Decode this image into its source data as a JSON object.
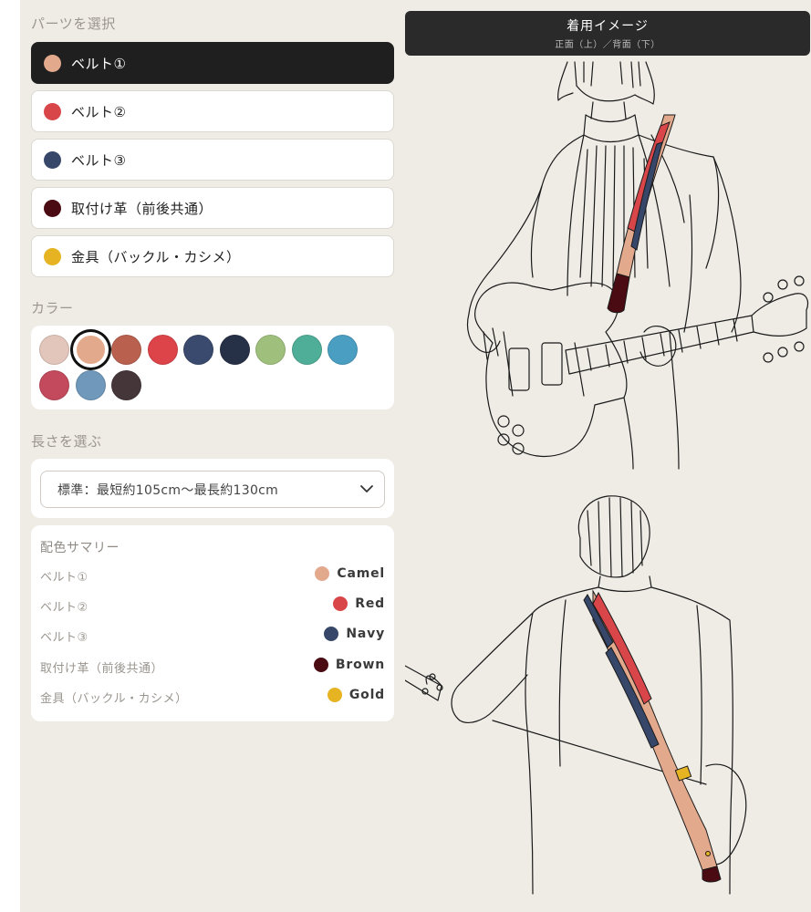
{
  "sections": {
    "parts_label": "パーツを選択",
    "color_label": "カラー",
    "length_label": "長さを選ぶ"
  },
  "parts": [
    {
      "label": "ベルト①",
      "color": "#e3a98c",
      "active": true
    },
    {
      "label": "ベルト②",
      "color": "#d9464a",
      "active": false
    },
    {
      "label": "ベルト③",
      "color": "#36476a",
      "active": false
    },
    {
      "label": "取付け革（前後共通）",
      "color": "#4a0b12",
      "active": false
    },
    {
      "label": "金具（バックル・カシメ）",
      "color": "#e6b323",
      "active": false
    }
  ],
  "swatches": [
    {
      "name": "pink-beige",
      "color": "#e3c6bb"
    },
    {
      "name": "camel",
      "color": "#e3a98c",
      "selected": true
    },
    {
      "name": "terracotta",
      "color": "#b9604f"
    },
    {
      "name": "red",
      "color": "#dc4449"
    },
    {
      "name": "navy",
      "color": "#3a4a6e"
    },
    {
      "name": "dark-navy",
      "color": "#263046"
    },
    {
      "name": "green",
      "color": "#9fc07c"
    },
    {
      "name": "teal",
      "color": "#4fae97"
    },
    {
      "name": "blue",
      "color": "#4a9ec2"
    },
    {
      "name": "rose",
      "color": "#c24a5c"
    },
    {
      "name": "steel-blue",
      "color": "#6f98ba"
    },
    {
      "name": "dark-brown",
      "color": "#45363a"
    }
  ],
  "length": {
    "selected": "標準：最短約105cm〜最長約130cm"
  },
  "summary": {
    "title": "配色サマリー",
    "rows": [
      {
        "label": "ベルト①",
        "value": "Camel",
        "color": "#e3a98c"
      },
      {
        "label": "ベルト②",
        "value": "Red",
        "color": "#d9464a"
      },
      {
        "label": "ベルト③",
        "value": "Navy",
        "color": "#36476a"
      },
      {
        "label": "取付け革（前後共通）",
        "value": "Brown",
        "color": "#4a0b12"
      },
      {
        "label": "金具（バックル・カシメ）",
        "value": "Gold",
        "color": "#e6b323"
      }
    ]
  },
  "preview": {
    "title": "着用イメージ",
    "subtitle": "正面（上）／背面（下）"
  }
}
